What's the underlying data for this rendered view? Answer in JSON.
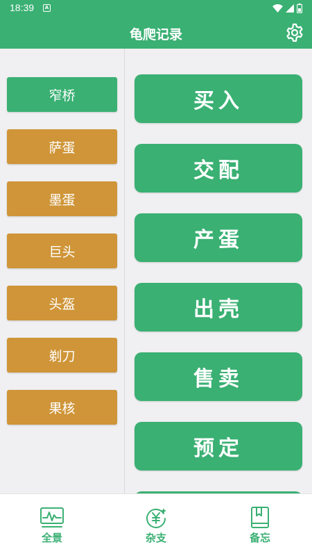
{
  "status_bar": {
    "time": "18:39",
    "notification_glyph": "A"
  },
  "app_bar": {
    "title": "龟爬记录",
    "settings_icon": "gear-icon"
  },
  "species": [
    {
      "label": "窄桥",
      "state": "active"
    },
    {
      "label": "萨蛋",
      "state": "inactive"
    },
    {
      "label": "墨蛋",
      "state": "inactive"
    },
    {
      "label": "巨头",
      "state": "inactive"
    },
    {
      "label": "头盔",
      "state": "inactive"
    },
    {
      "label": "剃刀",
      "state": "inactive"
    },
    {
      "label": "果核",
      "state": "inactive"
    }
  ],
  "actions": [
    {
      "label": "买入"
    },
    {
      "label": "交配"
    },
    {
      "label": "产蛋"
    },
    {
      "label": "出壳"
    },
    {
      "label": "售卖"
    },
    {
      "label": "预定"
    }
  ],
  "bottom_nav": [
    {
      "label": "全景",
      "icon": "overview-chart-icon"
    },
    {
      "label": "杂支",
      "icon": "yuan-coin-icon"
    },
    {
      "label": "备忘",
      "icon": "notebook-icon"
    }
  ],
  "colors": {
    "primary": "#3ab073",
    "inactive": "#cf9538",
    "background": "#f0f0f2"
  }
}
